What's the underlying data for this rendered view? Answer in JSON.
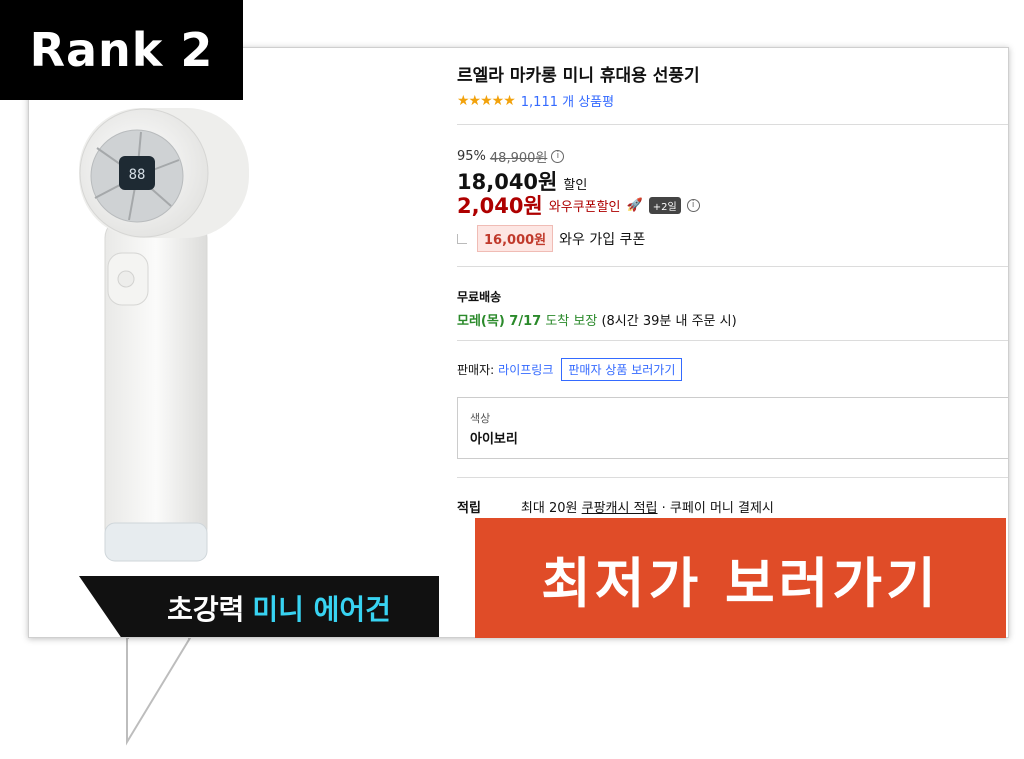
{
  "rank_badge": "Rank 2",
  "product": {
    "title": "르엘라 마카롱 미니 휴대용 선풍기",
    "stars": "★★★★★",
    "review_count": "1,111 개 상품평",
    "discount_rate": "95%",
    "original_price": "48,900원",
    "sale_price": "18,040원",
    "sale_label": "할인",
    "wow_price": "2,040원",
    "wow_label": "와우쿠폰할인",
    "wow_plus": "+2일",
    "coupon_amount": "16,000원",
    "coupon_label": "와우 가입 쿠폰",
    "shipping_header": "무료배송",
    "shipping_date": "모레(목) 7/17",
    "shipping_guarantee": "도착 보장",
    "shipping_note": "(8시간 39분 내 주문 시)",
    "seller_label": "판매자:",
    "seller_name": "라이프링크",
    "seller_button": "판매자 상품 보러가기",
    "option_label": "색상",
    "option_value": "아이보리",
    "point_header": "적립",
    "point_text_a": "최대 20원",
    "point_text_b": "쿠팡캐시 적립",
    "point_text_c": "· 쿠페이 머니 결제시"
  },
  "image_caption": {
    "white": "초강력",
    "accent": "미니 에어건"
  },
  "cta": "최저가 보러가기",
  "colors": {
    "cta_bg": "#e04c28",
    "link_blue": "#346aff",
    "wow_red": "#ae0000",
    "green": "#2b8a2b",
    "caption_accent": "#38d3f2"
  }
}
